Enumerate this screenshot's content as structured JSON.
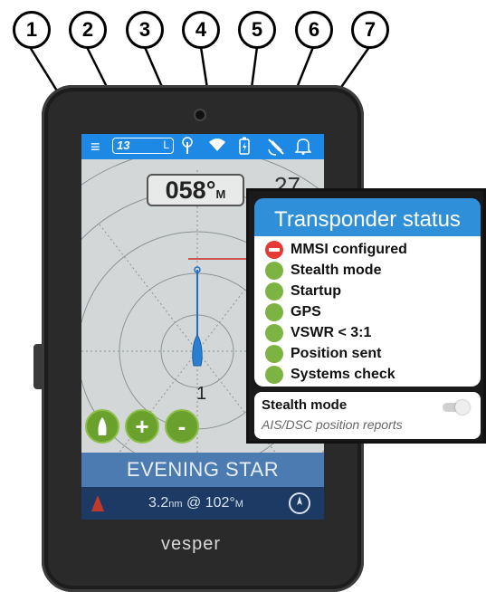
{
  "callouts": [
    "1",
    "2",
    "3",
    "4",
    "5",
    "6",
    "7"
  ],
  "status_bar": {
    "menu_icon": "hamburger-menu-icon",
    "channel": "13",
    "channel_suffix": "L",
    "icons": [
      "antenna-icon",
      "wifi-icon",
      "battery-icon",
      "gps-off-icon",
      "bell-icon"
    ]
  },
  "radar": {
    "heading": "058°",
    "heading_unit": "M",
    "side_value": "27",
    "target_number": "1"
  },
  "controls": [
    "boat-icon",
    "+",
    "-"
  ],
  "vessel": {
    "name": "EVENING STAR",
    "distance": "3.2",
    "distance_unit": "nm",
    "bearing_sep": "@",
    "bearing": "102°",
    "bearing_unit": "M"
  },
  "brand": "vesper",
  "popup": {
    "title": "Transponder status",
    "items": [
      {
        "label": "MMSI configured",
        "status": "error"
      },
      {
        "label": "Stealth mode",
        "status": "ok"
      },
      {
        "label": "Startup",
        "status": "ok"
      },
      {
        "label": "GPS",
        "status": "ok"
      },
      {
        "label": "VSWR < 3:1",
        "status": "ok"
      },
      {
        "label": "Position sent",
        "status": "ok"
      },
      {
        "label": "Systems check",
        "status": "ok"
      }
    ],
    "stealth_title": "Stealth mode",
    "stealth_subtitle": "AIS/DSC position reports",
    "stealth_enabled": false
  },
  "colors": {
    "accent": "#1e88e5",
    "ok": "#7cb342",
    "error": "#e53935",
    "namebar": "#4b7bb1"
  }
}
